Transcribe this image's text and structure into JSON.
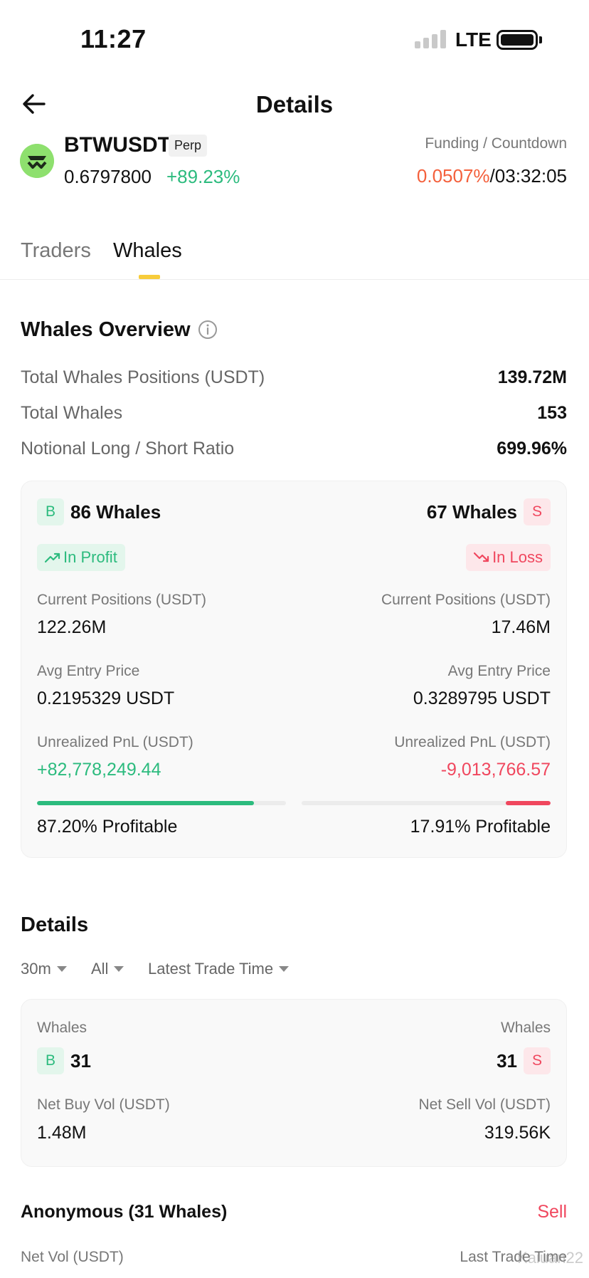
{
  "status_bar": {
    "time": "11:27",
    "network": "LTE"
  },
  "header": {
    "title": "Details"
  },
  "ticker": {
    "symbol": "BTWUSDT",
    "type_badge": "Perp",
    "price": "0.6797800",
    "change": "+89.23%",
    "funding_label": "Funding / Countdown",
    "funding_rate": "0.0507%",
    "separator": "/",
    "countdown": "03:32:05"
  },
  "tabs": [
    {
      "label": "Traders",
      "active": false
    },
    {
      "label": "Whales",
      "active": true
    }
  ],
  "overview": {
    "title": "Whales Overview",
    "stats": [
      {
        "label": "Total Whales Positions (USDT)",
        "value": "139.72M"
      },
      {
        "label": "Total Whales",
        "value": "153"
      },
      {
        "label": "Notional Long / Short Ratio",
        "value": "699.96%"
      }
    ],
    "long": {
      "badge": "B",
      "count": "86 Whales",
      "status": "In Profit",
      "positions_label": "Current Positions (USDT)",
      "positions": "122.26M",
      "entry_label": "Avg Entry Price",
      "entry": "0.2195329 USDT",
      "pnl_label": "Unrealized PnL (USDT)",
      "pnl": "+82,778,249.44",
      "profitable_fraction": 0.872,
      "profitable": "87.20% Profitable"
    },
    "short": {
      "badge": "S",
      "count": "67 Whales",
      "status": "In Loss",
      "positions_label": "Current Positions (USDT)",
      "positions": "17.46M",
      "entry_label": "Avg Entry Price",
      "entry": "0.3289795 USDT",
      "pnl_label": "Unrealized PnL (USDT)",
      "pnl": "-9,013,766.57",
      "profitable_fraction": 0.1791,
      "profitable": "17.91% Profitable"
    }
  },
  "details": {
    "title": "Details",
    "filters": [
      "30m",
      "All",
      "Latest Trade Time"
    ],
    "buy": {
      "whales_label": "Whales",
      "badge": "B",
      "count": "31",
      "vol_label": "Net Buy Vol (USDT)",
      "vol": "1.48M"
    },
    "sell": {
      "whales_label": "Whales",
      "badge": "S",
      "count": "31",
      "vol_label": "Net Sell Vol (USDT)",
      "vol": "319.56K"
    }
  },
  "trader": {
    "name": "Anonymous (31 Whales)",
    "side": "Sell",
    "net_vol_label": "Net Vol (USDT)",
    "last_trade_label": "Last Trade Time"
  },
  "watermark": "Kaiuan22",
  "colors": {
    "green": "#2cbb7e",
    "red": "#f0475e",
    "funding": "#f4603c",
    "accent": "#f7cc3b"
  },
  "icons": [
    "back-arrow-icon",
    "coin-logo-icon",
    "info-icon",
    "trend-up-icon",
    "trend-down-icon",
    "chevron-down-icon"
  ]
}
